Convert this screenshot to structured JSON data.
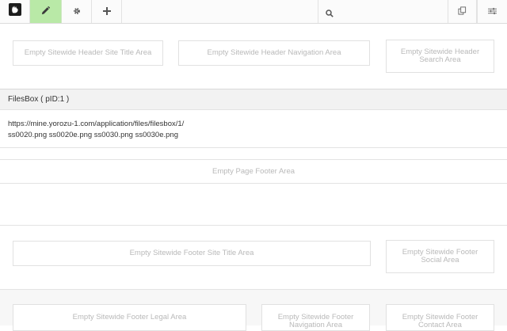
{
  "toolbar": {
    "search_value": "",
    "icons": [
      "concrete-logo-icon",
      "pencil-icon",
      "gear-icon",
      "plus-icon",
      "search-icon",
      "copy-icon",
      "sliders-icon"
    ],
    "active_color": "#b9e9a7"
  },
  "header": {
    "site_title": "Empty Sitewide Header Site Title Area",
    "navigation": "Empty Sitewide Header Navigation Area",
    "search": "Empty Sitewide Header Search Area"
  },
  "filesbox": {
    "title": "FilesBox ( pID:1 )",
    "url": "https://mine.yorozu-1.com/application/files/filesbox/1/",
    "files": "ss0020.png ss0020e.png ss0030.png ss0030e.png"
  },
  "page_footer": {
    "label": "Empty Page Footer Area"
  },
  "footer": {
    "site_title": "Empty Sitewide Footer Site Title Area",
    "social": "Empty Sitewide Footer Social Area",
    "legal": "Empty Sitewide Footer Legal Area",
    "navigation": "Empty Sitewide Footer Navigation Area",
    "contact": "Empty Sitewide Footer Contact Area"
  }
}
